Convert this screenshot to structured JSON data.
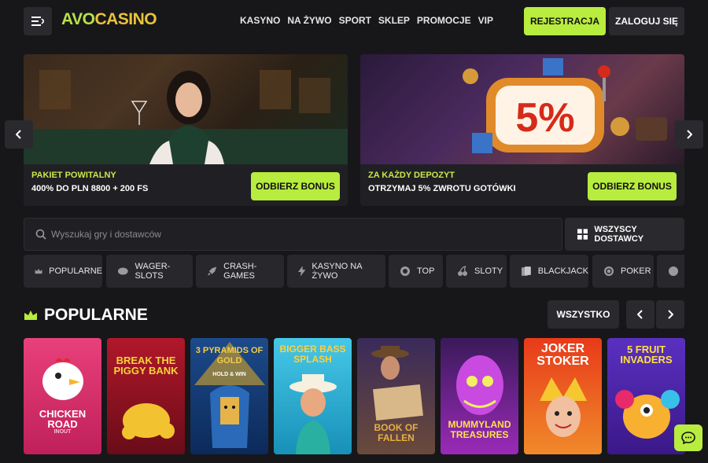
{
  "brand": {
    "part1": "AVO",
    "part2": "CASINO",
    "accent": "#b8ec3f",
    "gold": "#e9c33a"
  },
  "nav": [
    "KASYNO",
    "NA ŻYWO",
    "SPORT",
    "SKLEP",
    "PROMOCJE",
    "VIP"
  ],
  "auth": {
    "register": "REJESTRACJA",
    "login": "ZALOGUJ SIĘ"
  },
  "banners": [
    {
      "subtitle": "PAKIET POWITALNY",
      "title": "400% DO PLN 8800 + 200 FS",
      "button": "ODBIERZ BONUS"
    },
    {
      "subtitle": "ZA KAŻDY DEPOZYT",
      "title": "OTRZYMAJ 5% ZWROTU GOTÓWKI",
      "button": "ODBIERZ BONUS",
      "badge": "5%"
    }
  ],
  "search": {
    "placeholder": "Wyszukaj gry i dostawców"
  },
  "providers_button": "WSZYSCY DOSTAWCY",
  "categories": [
    {
      "label": "POPULARNE",
      "icon": "crown-icon"
    },
    {
      "label": "WAGER-SLOTS",
      "icon": "chip-icon"
    },
    {
      "label": "CRASH-GAMES",
      "icon": "rocket-icon"
    },
    {
      "label": "KASYNO NA ŻYWO",
      "icon": "lightning-icon"
    },
    {
      "label": "TOP",
      "icon": "badge-icon"
    },
    {
      "label": "SLOTY",
      "icon": "cherry-icon"
    },
    {
      "label": "BLACKJACK",
      "icon": "cards-icon"
    },
    {
      "label": "POKER",
      "icon": "poker-chip-icon"
    }
  ],
  "section": {
    "title": "POPULARNE",
    "all_button": "WSZYSTKO"
  },
  "games": [
    {
      "name": "CHICKEN ROAD",
      "sub": "INOUT"
    },
    {
      "name": "BREAK the PIGGY BANK",
      "sub": ""
    },
    {
      "name": "3 PYRAMIDS OF GOLD",
      "sub": "HOLD & WIN"
    },
    {
      "name": "BIGGER BASS SPLASH",
      "sub": ""
    },
    {
      "name": "BOOK OF FALLEN",
      "sub": ""
    },
    {
      "name": "MUMMYLAND TREASURES",
      "sub": ""
    },
    {
      "name": "JOKER STOKER",
      "sub": ""
    },
    {
      "name": "5 FRUIT INVADERS",
      "sub": ""
    }
  ]
}
